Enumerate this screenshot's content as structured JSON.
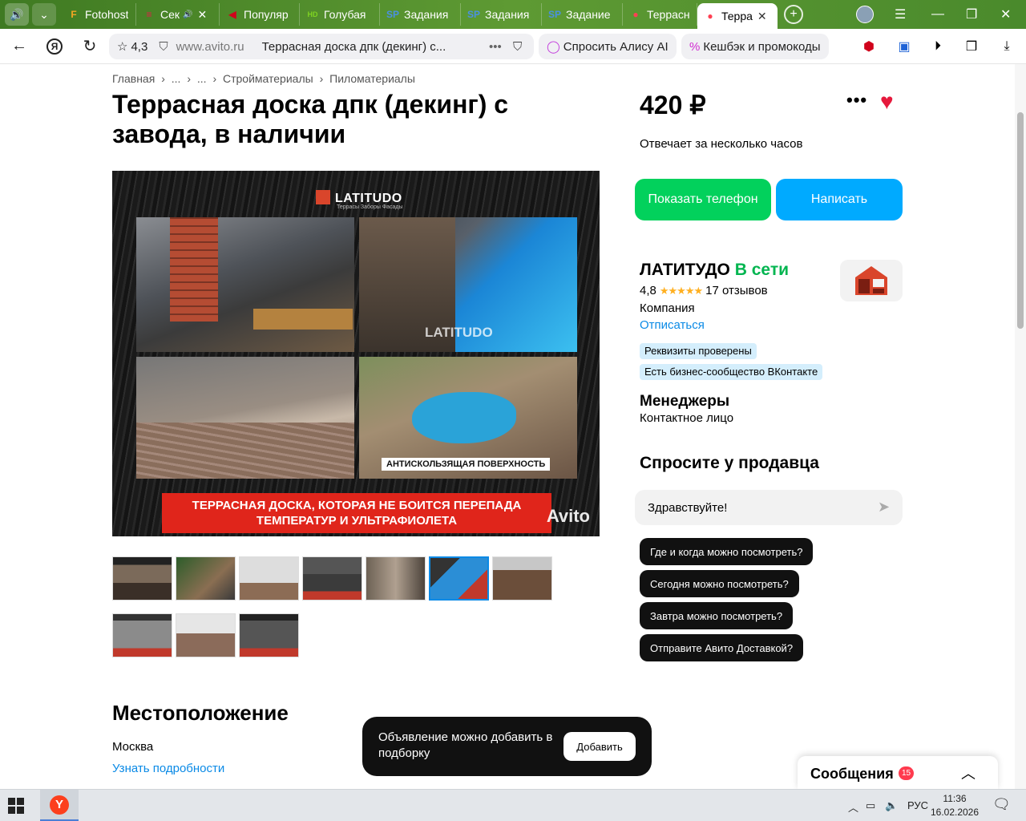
{
  "browser": {
    "tabs": [
      {
        "icon": "F",
        "title": "Fotohost",
        "color": "#f5a623"
      },
      {
        "icon": "≡",
        "title": "Сек",
        "audio": true,
        "close": "✕",
        "color": "#e11d48"
      },
      {
        "icon": "◀",
        "title": "Популяр",
        "color": "#d0021b"
      },
      {
        "icon": "HD",
        "title": "Голубая",
        "color": "#7ed321"
      },
      {
        "icon": "SP",
        "title": "Задания",
        "color": "#4a90e2"
      },
      {
        "icon": "SP",
        "title": "Задания",
        "color": "#4a90e2"
      },
      {
        "icon": "SP",
        "title": "Задание",
        "color": "#4a90e2"
      },
      {
        "icon": "●",
        "title": "Террасна",
        "color": "#ff4053"
      },
      {
        "icon": "●",
        "title": "Терра",
        "close": "✕",
        "active": true,
        "color": "#ff4053"
      }
    ],
    "rating": "4,3",
    "url": "www.avito.ru",
    "page_title": "Террасная доска дпк (декинг) с...",
    "alice": "Спросить Алису AI",
    "cashback": "Кешбэк и промокоды"
  },
  "breadcrumb": [
    "Главная",
    "›",
    "...",
    "›",
    "...",
    "›",
    "Стройматериалы",
    "›",
    "Пиломатериалы"
  ],
  "listing": {
    "title": "Террасная доска дпк (декинг) с завода, в наличии",
    "photo": {
      "brand": "LATITUDO",
      "brand_sub": "Террасы  Заборы  Фасады",
      "watermark": "LATITUDO",
      "badge": "АНТИСКОЛЬЗЯЩАЯ ПОВЕРХНОСТЬ",
      "banner_line1": "ТЕРРАСНАЯ ДОСКА, КОТОРАЯ НЕ БОИТСЯ ПЕРЕПАДА",
      "banner_line2": "ТЕМПЕРАТУР И УЛЬТРАФИОЛЕТА",
      "avito": "Avito"
    },
    "thumbnail_count": 10,
    "selected_thumbnail": 5
  },
  "location": {
    "title": "Местоположение",
    "city": "Москва",
    "more": "Узнать подробности"
  },
  "sidebar": {
    "price": "420 ₽",
    "more": "•••",
    "heart": "♥",
    "replies": "Отвечает за несколько часов",
    "show_phone": "Показать телефон",
    "write": "Написать",
    "seller_name": "ЛАТИТУДО",
    "seller_status": "В сети",
    "rating_value": "4,8",
    "stars": "★★★★★",
    "reviews": "17 отзывов",
    "seller_type": "Компания",
    "unsubscribe": "Отписаться",
    "tags": [
      "Реквизиты проверены",
      "Есть бизнес-сообщество ВКонтакте"
    ],
    "managers": "Менеджеры",
    "contact": "Контактное лицо",
    "ask_title": "Спросите у продавца",
    "ask_value": "Здравствуйте!",
    "quick_questions": [
      "Где и когда можно посмотреть?",
      "Сегодня можно посмотреть?",
      "Завтра можно посмотреть?",
      "Отправите Авито Доставкой?"
    ]
  },
  "toast": {
    "text": "Объявление можно добавить в подборку",
    "button": "Добавить"
  },
  "messages": {
    "title": "Сообщения",
    "badge": "15"
  },
  "taskbar": {
    "lang": "РУС",
    "time": "11:36",
    "date": "16.02.2026"
  },
  "colors": {
    "green": "#02d15c",
    "blue": "#00aaff",
    "link": "#0a8ae6",
    "heart": "#e6193c",
    "online": "#02b550"
  }
}
